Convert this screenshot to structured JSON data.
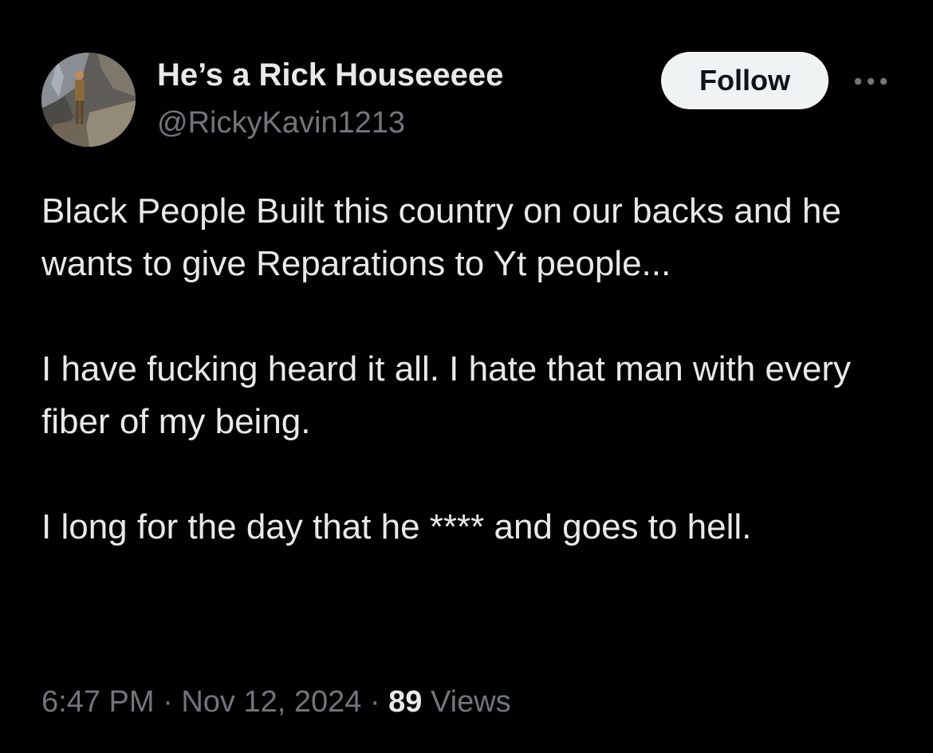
{
  "author": {
    "display_name": "He’s a Rick Houseeeee",
    "handle": "@RickyKavin1213",
    "avatar_icon": "profile-photo"
  },
  "actions": {
    "follow_label": "Follow",
    "more_icon": "more-horizontal-icon"
  },
  "tweet": {
    "paragraphs": [
      "Black People Built this country on our backs and he wants to give Reparations to Yt people...",
      "I have fucking heard it all. I hate that man with every fiber of my being.",
      "I long for the day that he **** and goes to hell."
    ],
    "time": "6:47 PM",
    "separator": "·",
    "date": "Nov 12, 2024",
    "views_count": "89",
    "views_label": "Views"
  },
  "colors": {
    "background": "#000000",
    "primary_text": "#e7e9ea",
    "secondary_text": "#71767b",
    "follow_bg": "#eff3f4",
    "follow_text": "#0f1419"
  }
}
